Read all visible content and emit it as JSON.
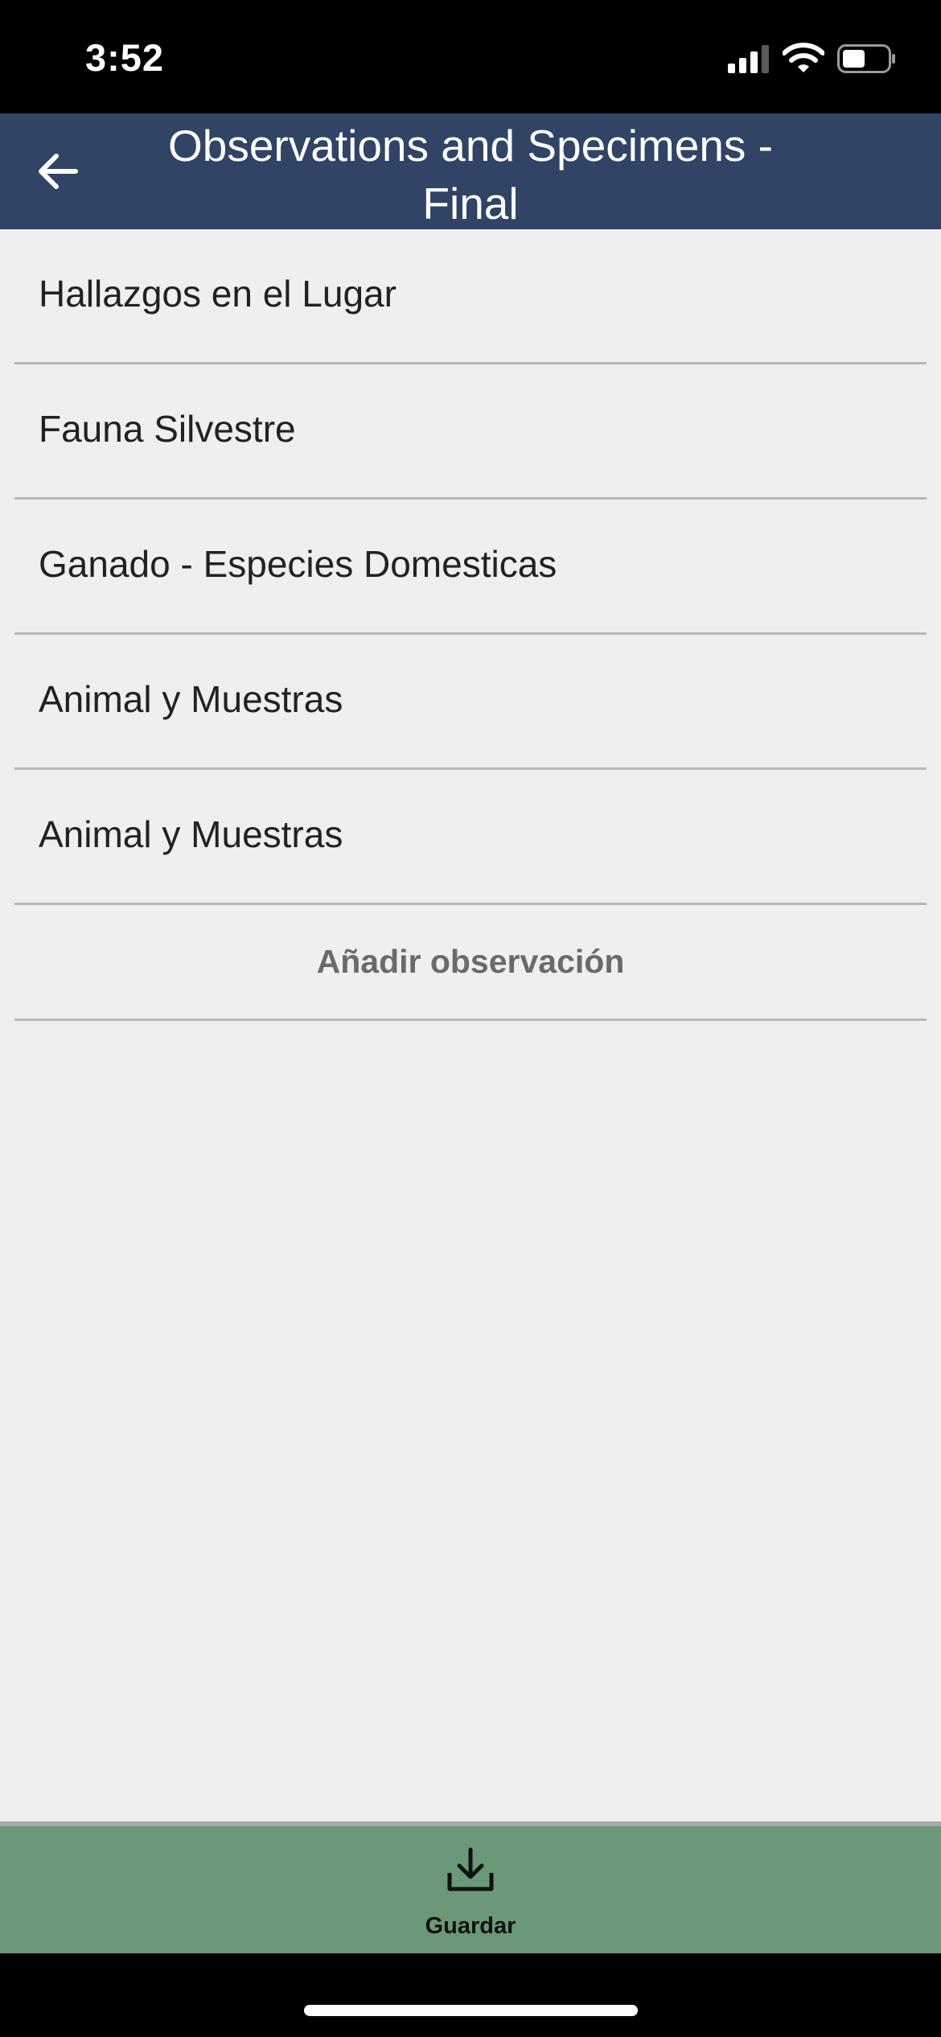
{
  "status_bar": {
    "time": "3:52",
    "icons": [
      "cellular-signal-icon",
      "wifi-icon",
      "battery-icon"
    ]
  },
  "header": {
    "title": "Observations and Specimens - Final",
    "back_icon": "arrow-left-icon",
    "background_color": "#314465"
  },
  "list": {
    "items": [
      {
        "label": "Hallazgos en el Lugar"
      },
      {
        "label": "Fauna Silvestre"
      },
      {
        "label": "Ganado - Especies Domesticas"
      },
      {
        "label": "Animal y Muestras"
      },
      {
        "label": "Animal y Muestras"
      }
    ],
    "add_label": "Añadir observación"
  },
  "bottom_bar": {
    "save_label": "Guardar",
    "save_icon": "download-icon",
    "background_color": "#6b9878"
  }
}
